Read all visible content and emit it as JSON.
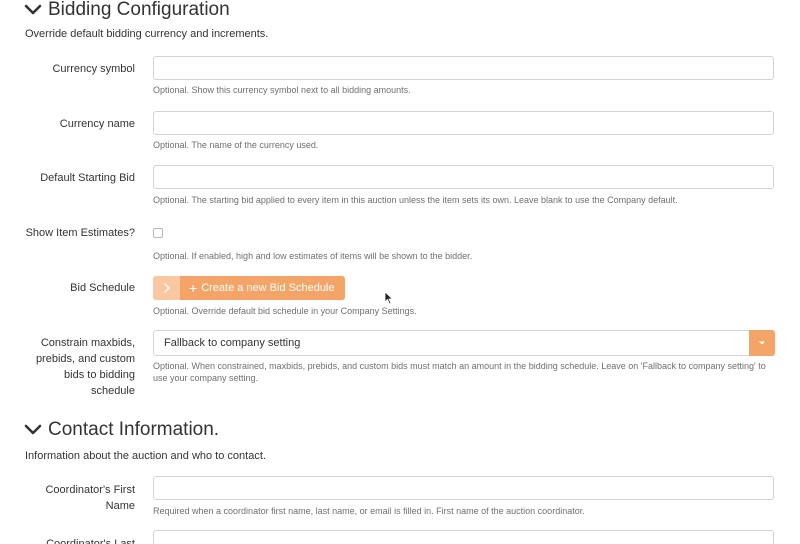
{
  "bidding": {
    "title": "Bidding Configuration",
    "description": "Override default bidding currency and increments.",
    "currency_symbol": {
      "label": "Currency symbol",
      "value": "",
      "help": "Optional. Show this currency symbol next to all bidding amounts."
    },
    "currency_name": {
      "label": "Currency name",
      "value": "",
      "help": "Optional. The name of the currency used."
    },
    "default_starting_bid": {
      "label": "Default Starting Bid",
      "value": "",
      "help": "Optional. The starting bid applied to every item in this auction unless the item sets its own. Leave blank to use the Company default."
    },
    "show_item_estimates": {
      "label": "Show Item Estimates?",
      "checked": false,
      "help": "Optional. If enabled, high and low estimates of items will be shown to the bidder."
    },
    "bid_schedule": {
      "label": "Bid Schedule",
      "button_label": "Create a new Bid Schedule",
      "help": "Optional. Override default bid schedule in your Company Settings."
    },
    "constrain": {
      "label_lines": [
        "Constrain maxbids,",
        "prebids, and custom",
        "bids to bidding",
        "schedule"
      ],
      "selected": "Fallback to company setting",
      "help": "Optional. When constrained, maxbids, prebids, and custom bids must match an amount in the bidding schedule. Leave on 'Fallback to company setting' to use your company setting."
    }
  },
  "contact": {
    "title": "Contact Information.",
    "description": "Information about the auction and who to contact.",
    "first_name": {
      "label_lines": [
        "Coordinator's First",
        "Name"
      ],
      "value": "",
      "help": "Required when a coordinator first name, last name, or email is filled in. First name of the auction coordinator."
    },
    "last_name": {
      "label_lines": [
        "Coordinator's Last"
      ],
      "value": ""
    }
  },
  "colors": {
    "accent": "#f5a468",
    "accent_light": "#fbc7a2",
    "border": "#d4d4d4",
    "help_text": "#6f6f6f"
  }
}
